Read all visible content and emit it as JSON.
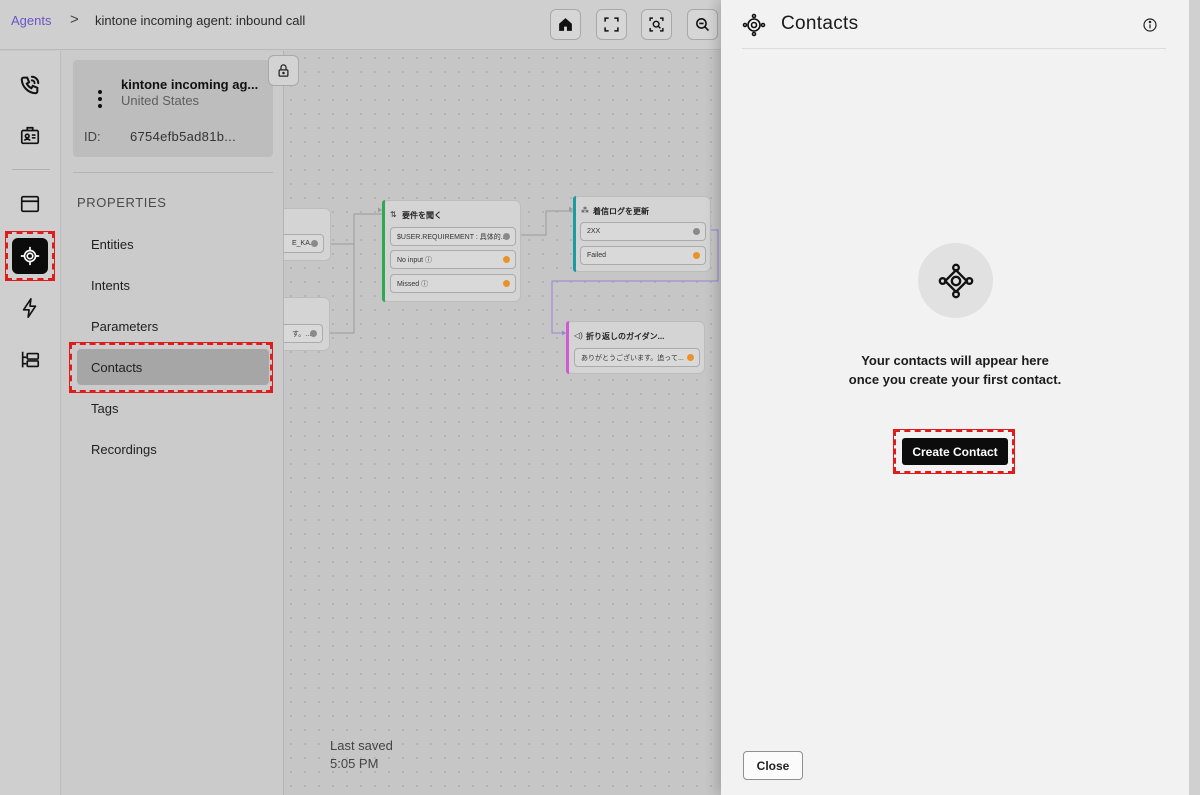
{
  "breadcrumb": {
    "root": "Agents",
    "separator": ">",
    "current": "kintone incoming agent: inbound call"
  },
  "toolbar": {
    "icons": [
      "home-icon",
      "fullscreen-icon",
      "focus-search-icon",
      "zoom-out-icon"
    ]
  },
  "rail": {
    "icons": [
      "phone-call-icon",
      "contact-card-icon",
      "window-icon",
      "properties-network-icon",
      "lightning-icon",
      "tree-list-icon"
    ],
    "active": "properties-network-icon"
  },
  "agent": {
    "name": "kintone incoming ag...",
    "country": "United States",
    "id_label": "ID:",
    "id_value": "6754efb5ad81b..."
  },
  "properties": {
    "title": "PROPERTIES",
    "items": [
      {
        "label": "Entities"
      },
      {
        "label": "Intents"
      },
      {
        "label": "Parameters"
      },
      {
        "label": "Contacts",
        "active": true
      },
      {
        "label": "Tags"
      },
      {
        "label": "Recordings"
      }
    ]
  },
  "canvas": {
    "nodes": {
      "partial_a": {
        "pill": "E_KA..."
      },
      "partial_b": {
        "pill": "す。..."
      },
      "ask_requirement": {
        "icon": "⇅",
        "title": "要件を聞く",
        "pills": [
          "$USER.REQUIREMENT : 具体的...",
          "No input ⓘ",
          "Missed ⓘ"
        ]
      },
      "update_log": {
        "icon": "⁂",
        "title": "着信ログを更新",
        "pills": [
          "2XX",
          "Failed"
        ]
      },
      "callback_guidance": {
        "icon": "◁)",
        "title": "折り返しのガイダン...",
        "pills": [
          "ありがとうございます。追って..."
        ]
      }
    },
    "last_saved_label": "Last saved",
    "last_saved_time": "5:05 PM"
  },
  "drawer": {
    "title": "Contacts",
    "empty_message": "Your contacts will appear here once you create your first contact.",
    "create_label": "Create Contact",
    "close_label": "Close"
  },
  "colors": {
    "accent_link": "#6a55c8",
    "node_green": "#2fa84f",
    "node_teal": "#1e9aa0",
    "node_pink": "#d05bd0",
    "dot_orange": "#e8932a",
    "dot_gray": "#8a8a8a"
  }
}
